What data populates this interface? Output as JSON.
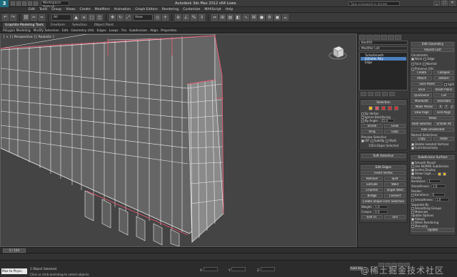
{
  "window": {
    "title": "Autodesk 3ds Max 2012 x64     Lowe",
    "workspace": "Workspace: Default",
    "search_placeholder": "Type a keyword or phrase",
    "controls": [
      "_",
      "□",
      "✕"
    ]
  },
  "menu": [
    "Edit",
    "Tools",
    "Group",
    "Views",
    "Create",
    "Modifiers",
    "Animation",
    "Graph Editors",
    "Rendering",
    "Customize",
    "MAXScript",
    "Help"
  ],
  "toolbar": {
    "selection_set": "All",
    "view_mode": "View"
  },
  "ribbon": {
    "tabs": [
      "Graphite Modeling Tools",
      "Freeform",
      "Selection",
      "Object Paint"
    ],
    "active_tab": "Graphite Modeling Tools",
    "subtabs": [
      "Polygon Modeling",
      "Modify Selection",
      "Edit",
      "Geometry (All)",
      "Edges",
      "Loops",
      "Tris",
      "Subdivision",
      "Align",
      "Properties"
    ]
  },
  "viewport": {
    "label": "[ + ] [ Perspective ] [ Realistic ]"
  },
  "command_panel": {
    "object_name": "Box001",
    "modifier_list_label": "Modifier List",
    "stack": [
      {
        "label": "TurboSmooth",
        "selected": false
      },
      {
        "label": "Editable Poly",
        "selected": true
      },
      {
        "label": "Edge",
        "selected": false
      }
    ],
    "selection": {
      "title": "Selection",
      "by_vertex": "By Vertex",
      "ignore_backfacing": "Ignore Backfacing",
      "by_angle": "By Angle:",
      "by_angle_value": "45.0",
      "shrink": "Shrink",
      "grow": "Grow",
      "ring": "Ring",
      "loop": "Loop",
      "preview_label": "Preview Selection",
      "preview_opts": [
        "Off",
        "SubObj",
        "Multi"
      ],
      "status": "1563 Edges Selected"
    },
    "soft_selection": {
      "title": "Soft Selection"
    },
    "edit_edges": {
      "title": "Edit Edges",
      "insert_vertex": "Insert Vertex",
      "remove": "Remove",
      "split": "Split",
      "extrude": "Extrude",
      "weld": "Weld",
      "chamfer": "Chamfer",
      "target_weld": "Target Weld",
      "bridge": "Bridge",
      "connect": "Connect",
      "create_shape": "Create Shape From Selection",
      "weight_label": "Weight:",
      "weight_value": "1.0",
      "crease_label": "Crease:",
      "crease_value": "0.0",
      "edit_tri": "Edit Tri.",
      "turn": "Turn"
    },
    "edit_geometry": {
      "title": "Edit Geometry",
      "repeat_last": "Repeat Last",
      "constraints": "Constraints",
      "constraint_opts": [
        "None",
        "Edge",
        "Face",
        "Normal"
      ],
      "preserve_uvs": "Preserve UVs",
      "create": "Create",
      "collapse": "Collapse",
      "attach": "Attach",
      "detach": "Detach",
      "slice_plane": "Slice Plane",
      "split": "Split",
      "slice": "Slice",
      "reset_plane": "Reset Plane",
      "quickslice": "QuickSlice",
      "cut": "Cut",
      "msmooth": "MSmooth",
      "tessellate": "Tessellate",
      "make_planar": "Make Planar",
      "xyz": [
        "X",
        "Y",
        "Z"
      ],
      "view_align": "View Align",
      "grid_align": "Grid Align",
      "relax": "Relax",
      "hide_selected": "Hide Selected",
      "unhide_all": "Unhide All",
      "hide_unselected": "Hide Unselected",
      "named_selections": "Named Selections:",
      "copy": "Copy",
      "paste": "Paste",
      "delete_isolated": "Delete Isolated Vertices",
      "full_interactivity": "Full Interactivity"
    },
    "subdivision_surface": {
      "title": "Subdivision Surface",
      "smooth_result": "Smooth Result",
      "use_nurms": "Use NURMS Subdivision",
      "isoline": "Isoline Display",
      "show_cage": "Show Cage......",
      "cage_colors": [
        "#e8b830",
        "#e8b830"
      ],
      "display": "Display",
      "iterations_label": "Iterations:",
      "iterations_value": "1",
      "smoothness_label": "Smoothness:",
      "smoothness_value": "1.0",
      "render": "Render",
      "render_iterations_value": "0",
      "render_smoothness_value": "1.0",
      "separate_by": "Separate By",
      "smoothing_groups": "Smoothing Groups",
      "materials": "Materials",
      "update_options": "Update Options",
      "always": "Always",
      "when_rendering": "When Rendering",
      "manually": "Manually",
      "update": "Update"
    }
  },
  "timeline": {
    "frame": "0 / 100"
  },
  "status": {
    "maxscript": "Max to Physc.",
    "line1": "1 Object Selected",
    "line2": "Click or click-and-drag to select objects",
    "coord_labels": [
      "X:",
      "Y:",
      "Z:"
    ],
    "auto_key": "Auto Key",
    "set_key": "Set Key",
    "selected_label": "Selected",
    "key_filters": "Key Filters..."
  },
  "watermark": "@稀土掘金技术社区",
  "colors": {
    "selection_edge": "#e0546a",
    "wire": "#f0f0f0",
    "viewport_bg": "#444444",
    "accent": "#4b7fbf"
  }
}
